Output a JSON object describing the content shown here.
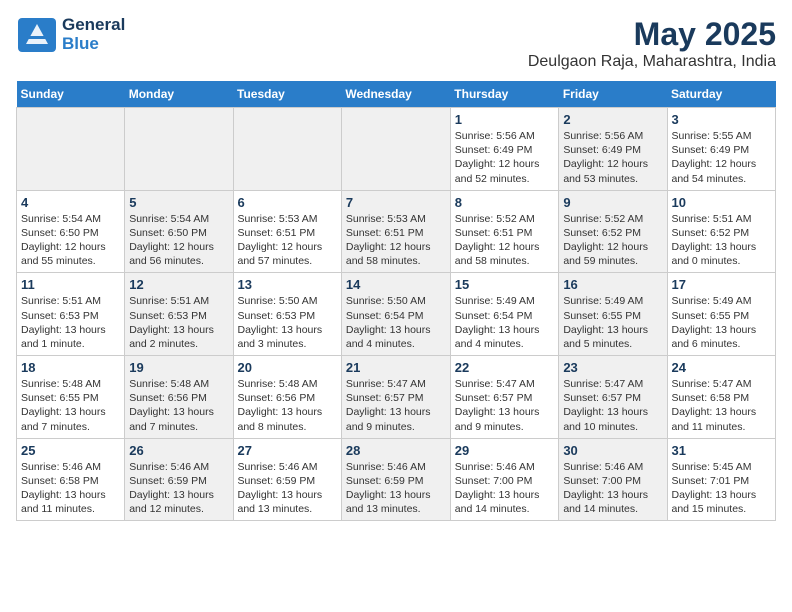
{
  "logo": {
    "general": "General",
    "blue": "Blue"
  },
  "title": "May 2025",
  "location": "Deulgaon Raja, Maharashtra, India",
  "weekdays": [
    "Sunday",
    "Monday",
    "Tuesday",
    "Wednesday",
    "Thursday",
    "Friday",
    "Saturday"
  ],
  "weeks": [
    [
      {
        "num": "",
        "info": "",
        "shaded": true
      },
      {
        "num": "",
        "info": "",
        "shaded": true
      },
      {
        "num": "",
        "info": "",
        "shaded": true
      },
      {
        "num": "",
        "info": "",
        "shaded": true
      },
      {
        "num": "1",
        "info": "Sunrise: 5:56 AM\nSunset: 6:49 PM\nDaylight: 12 hours\nand 52 minutes.",
        "shaded": false
      },
      {
        "num": "2",
        "info": "Sunrise: 5:56 AM\nSunset: 6:49 PM\nDaylight: 12 hours\nand 53 minutes.",
        "shaded": true
      },
      {
        "num": "3",
        "info": "Sunrise: 5:55 AM\nSunset: 6:49 PM\nDaylight: 12 hours\nand 54 minutes.",
        "shaded": false
      }
    ],
    [
      {
        "num": "4",
        "info": "Sunrise: 5:54 AM\nSunset: 6:50 PM\nDaylight: 12 hours\nand 55 minutes.",
        "shaded": false
      },
      {
        "num": "5",
        "info": "Sunrise: 5:54 AM\nSunset: 6:50 PM\nDaylight: 12 hours\nand 56 minutes.",
        "shaded": true
      },
      {
        "num": "6",
        "info": "Sunrise: 5:53 AM\nSunset: 6:51 PM\nDaylight: 12 hours\nand 57 minutes.",
        "shaded": false
      },
      {
        "num": "7",
        "info": "Sunrise: 5:53 AM\nSunset: 6:51 PM\nDaylight: 12 hours\nand 58 minutes.",
        "shaded": true
      },
      {
        "num": "8",
        "info": "Sunrise: 5:52 AM\nSunset: 6:51 PM\nDaylight: 12 hours\nand 58 minutes.",
        "shaded": false
      },
      {
        "num": "9",
        "info": "Sunrise: 5:52 AM\nSunset: 6:52 PM\nDaylight: 12 hours\nand 59 minutes.",
        "shaded": true
      },
      {
        "num": "10",
        "info": "Sunrise: 5:51 AM\nSunset: 6:52 PM\nDaylight: 13 hours\nand 0 minutes.",
        "shaded": false
      }
    ],
    [
      {
        "num": "11",
        "info": "Sunrise: 5:51 AM\nSunset: 6:53 PM\nDaylight: 13 hours\nand 1 minute.",
        "shaded": false
      },
      {
        "num": "12",
        "info": "Sunrise: 5:51 AM\nSunset: 6:53 PM\nDaylight: 13 hours\nand 2 minutes.",
        "shaded": true
      },
      {
        "num": "13",
        "info": "Sunrise: 5:50 AM\nSunset: 6:53 PM\nDaylight: 13 hours\nand 3 minutes.",
        "shaded": false
      },
      {
        "num": "14",
        "info": "Sunrise: 5:50 AM\nSunset: 6:54 PM\nDaylight: 13 hours\nand 4 minutes.",
        "shaded": true
      },
      {
        "num": "15",
        "info": "Sunrise: 5:49 AM\nSunset: 6:54 PM\nDaylight: 13 hours\nand 4 minutes.",
        "shaded": false
      },
      {
        "num": "16",
        "info": "Sunrise: 5:49 AM\nSunset: 6:55 PM\nDaylight: 13 hours\nand 5 minutes.",
        "shaded": true
      },
      {
        "num": "17",
        "info": "Sunrise: 5:49 AM\nSunset: 6:55 PM\nDaylight: 13 hours\nand 6 minutes.",
        "shaded": false
      }
    ],
    [
      {
        "num": "18",
        "info": "Sunrise: 5:48 AM\nSunset: 6:55 PM\nDaylight: 13 hours\nand 7 minutes.",
        "shaded": false
      },
      {
        "num": "19",
        "info": "Sunrise: 5:48 AM\nSunset: 6:56 PM\nDaylight: 13 hours\nand 7 minutes.",
        "shaded": true
      },
      {
        "num": "20",
        "info": "Sunrise: 5:48 AM\nSunset: 6:56 PM\nDaylight: 13 hours\nand 8 minutes.",
        "shaded": false
      },
      {
        "num": "21",
        "info": "Sunrise: 5:47 AM\nSunset: 6:57 PM\nDaylight: 13 hours\nand 9 minutes.",
        "shaded": true
      },
      {
        "num": "22",
        "info": "Sunrise: 5:47 AM\nSunset: 6:57 PM\nDaylight: 13 hours\nand 9 minutes.",
        "shaded": false
      },
      {
        "num": "23",
        "info": "Sunrise: 5:47 AM\nSunset: 6:57 PM\nDaylight: 13 hours\nand 10 minutes.",
        "shaded": true
      },
      {
        "num": "24",
        "info": "Sunrise: 5:47 AM\nSunset: 6:58 PM\nDaylight: 13 hours\nand 11 minutes.",
        "shaded": false
      }
    ],
    [
      {
        "num": "25",
        "info": "Sunrise: 5:46 AM\nSunset: 6:58 PM\nDaylight: 13 hours\nand 11 minutes.",
        "shaded": false
      },
      {
        "num": "26",
        "info": "Sunrise: 5:46 AM\nSunset: 6:59 PM\nDaylight: 13 hours\nand 12 minutes.",
        "shaded": true
      },
      {
        "num": "27",
        "info": "Sunrise: 5:46 AM\nSunset: 6:59 PM\nDaylight: 13 hours\nand 13 minutes.",
        "shaded": false
      },
      {
        "num": "28",
        "info": "Sunrise: 5:46 AM\nSunset: 6:59 PM\nDaylight: 13 hours\nand 13 minutes.",
        "shaded": true
      },
      {
        "num": "29",
        "info": "Sunrise: 5:46 AM\nSunset: 7:00 PM\nDaylight: 13 hours\nand 14 minutes.",
        "shaded": false
      },
      {
        "num": "30",
        "info": "Sunrise: 5:46 AM\nSunset: 7:00 PM\nDaylight: 13 hours\nand 14 minutes.",
        "shaded": true
      },
      {
        "num": "31",
        "info": "Sunrise: 5:45 AM\nSunset: 7:01 PM\nDaylight: 13 hours\nand 15 minutes.",
        "shaded": false
      }
    ]
  ]
}
